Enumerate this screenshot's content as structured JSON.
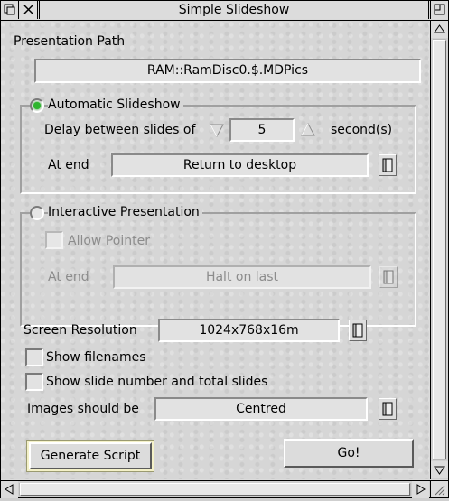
{
  "window": {
    "title": "Simple Slideshow"
  },
  "path": {
    "label": "Presentation Path",
    "value": "RAM::RamDisc0.$.MDPics"
  },
  "automatic": {
    "label": "Automatic Slideshow",
    "selected": true,
    "delay_label": "Delay between slides of",
    "delay_value": "5",
    "delay_unit": "second(s)",
    "at_end_label": "At end",
    "at_end_value": "Return to desktop"
  },
  "interactive": {
    "label": "Interactive Presentation",
    "selected": false,
    "allow_pointer_label": "Allow Pointer",
    "at_end_label": "At end",
    "at_end_value": "Halt on last"
  },
  "resolution": {
    "label": "Screen Resolution",
    "value": "1024x768x16m"
  },
  "options": {
    "show_filenames": "Show filenames",
    "show_slide_number": "Show slide number and total slides"
  },
  "images": {
    "label": "Images should be",
    "value": "Centred"
  },
  "buttons": {
    "generate": "Generate Script",
    "go": "Go!"
  },
  "colors": {
    "radio_on": "#2fb52f",
    "default_button": "#f4f1c8",
    "background": "#d6d6d6"
  }
}
